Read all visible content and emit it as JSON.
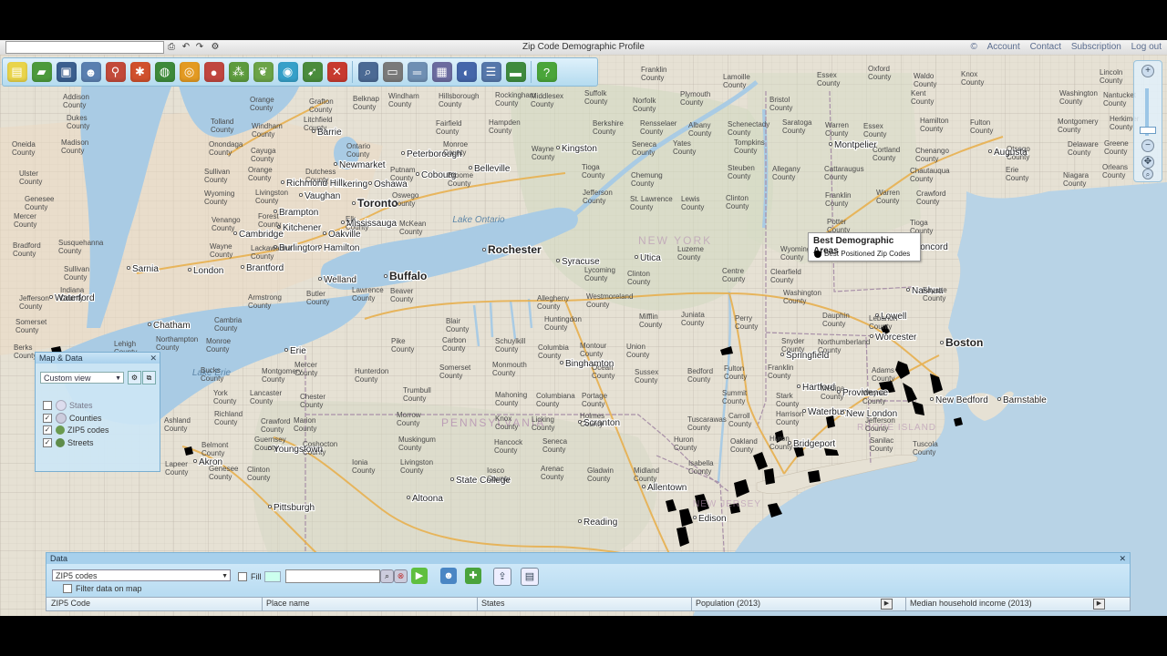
{
  "app": {
    "title": "Zip Code Demographic Profile",
    "links": [
      "Account",
      "Contact",
      "Subscription",
      "Log out"
    ]
  },
  "toolbar": {
    "tools": [
      {
        "icon": "new-doc-icon",
        "color": "#e9d44a"
      },
      {
        "icon": "open-folder-icon",
        "color": "#4c9a3c"
      },
      {
        "icon": "save-icon",
        "color": "#3a5f8f"
      },
      {
        "icon": "users-icon",
        "color": "#5a7fb0"
      },
      {
        "icon": "pin-person-icon",
        "color": "#c24a3a"
      },
      {
        "icon": "multi-pin-icon",
        "color": "#d0502d"
      },
      {
        "icon": "globe-icon",
        "color": "#3d8a3a"
      },
      {
        "icon": "ring-icon",
        "color": "#e39a22"
      },
      {
        "icon": "spheres-icon",
        "color": "#c0463f"
      },
      {
        "icon": "cluster-icon",
        "color": "#5d9b3e"
      },
      {
        "icon": "leaf-icon",
        "color": "#6ba347"
      },
      {
        "icon": "radius-icon",
        "color": "#36a0c9"
      },
      {
        "icon": "route-icon",
        "color": "#4a8c3c"
      },
      {
        "icon": "cancel-icon",
        "color": "#c73a2f"
      },
      {
        "icon": "search-zoom-icon",
        "color": "#4b6a94"
      },
      {
        "icon": "label-icon",
        "color": "#7a7a7a"
      },
      {
        "icon": "ruler-icon",
        "color": "#6f8fb3"
      },
      {
        "icon": "box-icon",
        "color": "#6b6b9f"
      },
      {
        "icon": "web-icon",
        "color": "#4466aa"
      },
      {
        "icon": "table-icon",
        "color": "#5577aa"
      },
      {
        "icon": "cash-icon",
        "color": "#3f8b3e"
      },
      {
        "icon": "help-icon",
        "color": "#4aa53a"
      }
    ]
  },
  "legend": {
    "title": "Best Demographic Areas",
    "item": "Best Positioned Zip Codes"
  },
  "map_data": {
    "title": "Map & Data",
    "view": "Custom view",
    "layers": [
      {
        "label": "States",
        "checked": false
      },
      {
        "label": "Counties",
        "checked": true
      },
      {
        "label": "ZIP5 codes",
        "checked": true
      },
      {
        "label": "Streets",
        "checked": true
      }
    ]
  },
  "data_panel": {
    "title": "Data",
    "layer_select": "ZIP5 codes",
    "filter_label": "Filter data on map",
    "fill_label": "Fill",
    "columns": [
      "ZIP5 Code",
      "Place name",
      "States",
      "Population (2013)",
      "Median household income (2013)"
    ]
  },
  "map": {
    "cities": [
      {
        "name": "Toronto",
        "big": true
      },
      {
        "name": "Buffalo",
        "big": true
      },
      {
        "name": "Rochester",
        "big": true
      },
      {
        "name": "Syracuse"
      },
      {
        "name": "Utica"
      },
      {
        "name": "Binghamton"
      },
      {
        "name": "Scranton"
      },
      {
        "name": "Allentown"
      },
      {
        "name": "Bridgeport"
      },
      {
        "name": "Providence"
      },
      {
        "name": "Boston",
        "big": true
      },
      {
        "name": "Nashua"
      },
      {
        "name": "Lowell"
      },
      {
        "name": "Worcester"
      },
      {
        "name": "Waterbury"
      },
      {
        "name": "New London"
      },
      {
        "name": "New Bedford"
      },
      {
        "name": "Barnstable"
      },
      {
        "name": "Concord"
      },
      {
        "name": "Augusta"
      },
      {
        "name": "Montpelier"
      },
      {
        "name": "Kingston"
      },
      {
        "name": "Belleville"
      },
      {
        "name": "Barrie"
      },
      {
        "name": "Newmarket"
      },
      {
        "name": "Peterborough"
      },
      {
        "name": "Cobourg"
      },
      {
        "name": "Oshawa"
      },
      {
        "name": "Pickering"
      },
      {
        "name": "Vaughan"
      },
      {
        "name": "Brampton"
      },
      {
        "name": "Mississauga"
      },
      {
        "name": "Oakville"
      },
      {
        "name": "Kitchener"
      },
      {
        "name": "Cambridge"
      },
      {
        "name": "Burlington"
      },
      {
        "name": "Hamilton"
      },
      {
        "name": "Brantford"
      },
      {
        "name": "London"
      },
      {
        "name": "Sarnia"
      },
      {
        "name": "Chatham"
      },
      {
        "name": "Welland"
      },
      {
        "name": "Erie"
      },
      {
        "name": "Akron"
      },
      {
        "name": "Youngstown"
      },
      {
        "name": "Pittsburgh"
      },
      {
        "name": "Altoona"
      },
      {
        "name": "State College"
      },
      {
        "name": "Reading"
      },
      {
        "name": "Edison"
      },
      {
        "name": "Toms River"
      },
      {
        "name": "Springfield"
      },
      {
        "name": "Hartford"
      },
      {
        "name": "Richmond Hill"
      },
      {
        "name": "Waterford"
      },
      {
        "name": "Columbus"
      },
      {
        "name": "Philadelphia"
      }
    ],
    "water": [
      "Lake Ontario",
      "Lake Erie"
    ],
    "regions": [
      "PENNSYLVANIA",
      "NEW YORK",
      "NEW JERSEY",
      "RHODE ISLAND"
    ],
    "counties": [
      "Franklin County",
      "Lamoille County",
      "Essex County",
      "Oxford County",
      "Waldo County",
      "Knox County",
      "Lincoln County",
      "Addison County",
      "Orange County",
      "Grafton County",
      "Belknap County",
      "Windham County",
      "Hillsborough County",
      "Rockingham County",
      "Middlesex County",
      "Suffolk County",
      "Norfolk County",
      "Plymouth County",
      "Bristol County",
      "Kent County",
      "Washington County",
      "Nantucket County",
      "Dukes County",
      "Tolland County",
      "Windham County",
      "Litchfield County",
      "Fairfield County",
      "Hampden County",
      "Berkshire County",
      "Rensselaer County",
      "Albany County",
      "Schenectady County",
      "Saratoga County",
      "Warren County",
      "Essex County",
      "Hamilton County",
      "Fulton County",
      "Montgomery County",
      "Herkimer County",
      "Oneida County",
      "Madison County",
      "Onondaga County",
      "Cayuga County",
      "Ontario County",
      "Monroe County",
      "Wayne County",
      "Seneca County",
      "Yates County",
      "Tompkins County",
      "Cortland County",
      "Chenango County",
      "Otsego County",
      "Delaware County",
      "Greene County",
      "Ulster County",
      "Sullivan County",
      "Orange County",
      "Dutchess County",
      "Putnam County",
      "Broome County",
      "Tioga County",
      "Chemung County",
      "Steuben County",
      "Allegany County",
      "Cattaraugus County",
      "Chautauqua County",
      "Erie County",
      "Niagara County",
      "Orleans County",
      "Genesee County",
      "Wyoming County",
      "Livingston County",
      "Oswego County",
      "Jefferson County",
      "St. Lawrence County",
      "Lewis County",
      "Clinton County",
      "Franklin County",
      "Warren County",
      "Crawford County",
      "Mercer County",
      "Venango County",
      "Forest County",
      "Elk County",
      "McKean County",
      "Potter County",
      "Tioga County",
      "Bradford County",
      "Susquehanna County",
      "Wayne County",
      "Lackawanna County",
      "Luzerne County",
      "Wyoming County",
      "Sullivan County",
      "Lycoming County",
      "Clinton County",
      "Centre County",
      "Clearfield County",
      "Jefferson County",
      "Indiana County",
      "Armstrong County",
      "Butler County",
      "Lawrence County",
      "Beaver County",
      "Allegheny County",
      "Westmoreland County",
      "Washington County",
      "Fayette County",
      "Somerset County",
      "Cambria County",
      "Blair County",
      "Huntingdon County",
      "Mifflin County",
      "Juniata County",
      "Perry County",
      "Dauphin County",
      "Lebanon County",
      "Berks County",
      "Lehigh County",
      "Northampton County",
      "Monroe County",
      "Pike County",
      "Carbon County",
      "Schuylkill County",
      "Columbia County",
      "Montour County",
      "Union County",
      "Snyder County",
      "Northumberland County",
      "Bucks County",
      "Montgomery County",
      "Mercer County",
      "Hunterdon County",
      "Somerset County",
      "Monmouth County",
      "Ocean County",
      "Sussex County",
      "Bedford County",
      "Fulton County",
      "Franklin County",
      "Adams County",
      "York County",
      "Lancaster County",
      "Chester County",
      "Trumbull County",
      "Mahoning County",
      "Columbiana County",
      "Portage County",
      "Summit County",
      "Stark County",
      "Medina County",
      "Wayne County",
      "Ashland County",
      "Richland County",
      "Crawford County",
      "Marion County",
      "Morrow County",
      "Knox County",
      "Licking County",
      "Holmes County",
      "Tuscarawas County",
      "Carroll County",
      "Harrison County",
      "Jefferson County",
      "Belmont County",
      "Guernsey County",
      "Coshocton County",
      "Muskingum County",
      "Hancock County",
      "Seneca County",
      "Huron County",
      "Oakland County",
      "Huron County",
      "Sanilac County",
      "Tuscola County",
      "Lapeer County",
      "Genesee County",
      "Clinton County",
      "Ionia County",
      "Livingston County",
      "Iosco County",
      "Arenac County",
      "Gladwin County",
      "Midland County",
      "Isabella County"
    ]
  }
}
